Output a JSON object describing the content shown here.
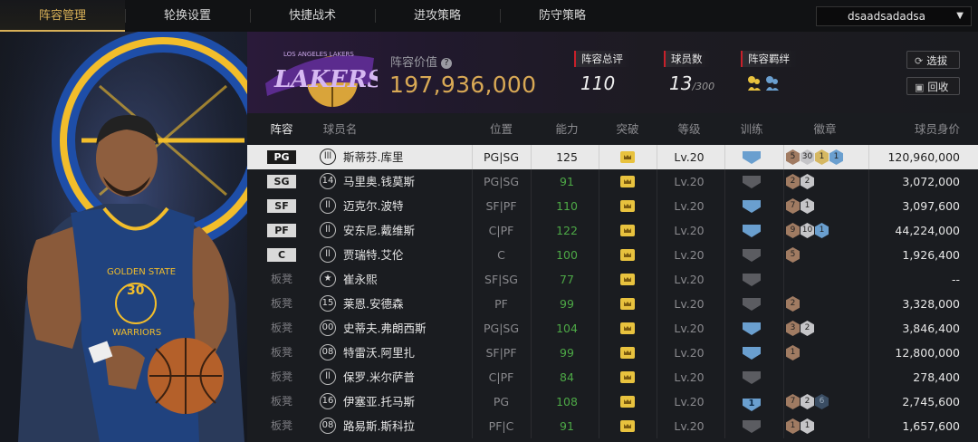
{
  "nav": {
    "tabs": [
      {
        "label": "阵容管理",
        "active": true
      },
      {
        "label": "轮换设置",
        "active": false
      },
      {
        "label": "快捷战术",
        "active": false
      },
      {
        "label": "进攻策略",
        "active": false
      },
      {
        "label": "防守策略",
        "active": false
      }
    ],
    "user": "dsaadsadadsa"
  },
  "header": {
    "team_logo_text": "LOS ANGELES LAKERS",
    "value_label": "阵容价值",
    "value": "197,936,000",
    "stats": [
      {
        "label": "阵容总评",
        "value": "110",
        "sub": ""
      },
      {
        "label": "球员数",
        "value": "13",
        "sub": "/300"
      },
      {
        "label": "阵容羁绊",
        "value": "",
        "sub": ""
      }
    ],
    "buttons": {
      "select": "选拔",
      "recycle": "回收"
    }
  },
  "table": {
    "columns": [
      "阵容",
      "球员名",
      "位置",
      "能力",
      "突破",
      "等级",
      "训练",
      "徽章",
      "球员身价"
    ],
    "rows": [
      {
        "slot": "PG",
        "bench": false,
        "jersey": "lll",
        "name": "斯蒂芬.库里",
        "position": "PG|SG",
        "rating": "125",
        "level": "Lv.20",
        "training": "blue",
        "training_num": "",
        "badges": [
          {
            "t": "bronze",
            "n": "5"
          },
          {
            "t": "silver",
            "n": "30"
          },
          {
            "t": "gold",
            "n": "1"
          },
          {
            "t": "blue",
            "n": "1"
          }
        ],
        "price": "120,960,000",
        "selected": true
      },
      {
        "slot": "SG",
        "bench": false,
        "jersey": "14",
        "name": "马里奥.钱莫斯",
        "position": "PG|SG",
        "rating": "91",
        "level": "Lv.20",
        "training": "grey",
        "training_num": "",
        "badges": [
          {
            "t": "bronze",
            "n": "2"
          },
          {
            "t": "silver",
            "n": "2"
          }
        ],
        "price": "3,072,000",
        "selected": false
      },
      {
        "slot": "SF",
        "bench": false,
        "jersey": "ll",
        "name": "迈克尔.波特",
        "position": "SF|PF",
        "rating": "110",
        "level": "Lv.20",
        "training": "blue",
        "training_num": "",
        "badges": [
          {
            "t": "bronze",
            "n": "7"
          },
          {
            "t": "silver",
            "n": "1"
          }
        ],
        "price": "3,097,600",
        "selected": false
      },
      {
        "slot": "PF",
        "bench": false,
        "jersey": "ll",
        "name": "安东尼.戴维斯",
        "position": "C|PF",
        "rating": "122",
        "level": "Lv.20",
        "training": "blue",
        "training_num": "",
        "badges": [
          {
            "t": "bronze",
            "n": "9"
          },
          {
            "t": "silver",
            "n": "10"
          },
          {
            "t": "blue",
            "n": "1"
          }
        ],
        "price": "44,224,000",
        "selected": false
      },
      {
        "slot": "C",
        "bench": false,
        "jersey": "ll",
        "name": "贾瑞特.艾伦",
        "position": "C",
        "rating": "100",
        "level": "Lv.20",
        "training": "grey",
        "training_num": "",
        "badges": [
          {
            "t": "bronze",
            "n": "5"
          }
        ],
        "price": "1,926,400",
        "selected": false
      },
      {
        "slot": "板凳",
        "bench": true,
        "jersey": "★",
        "name": "崔永熙",
        "position": "SF|SG",
        "rating": "77",
        "level": "Lv.20",
        "training": "grey",
        "training_num": "",
        "badges": [],
        "price": "--",
        "selected": false
      },
      {
        "slot": "板凳",
        "bench": true,
        "jersey": "15",
        "name": "莱恩.安德森",
        "position": "PF",
        "rating": "99",
        "level": "Lv.20",
        "training": "grey",
        "training_num": "",
        "badges": [
          {
            "t": "bronze",
            "n": "2"
          }
        ],
        "price": "3,328,000",
        "selected": false
      },
      {
        "slot": "板凳",
        "bench": true,
        "jersey": "00",
        "name": "史蒂夫.弗朗西斯",
        "position": "PG|SG",
        "rating": "104",
        "level": "Lv.20",
        "training": "blue",
        "training_num": "",
        "badges": [
          {
            "t": "bronze",
            "n": "3"
          },
          {
            "t": "silver",
            "n": "2"
          }
        ],
        "price": "3,846,400",
        "selected": false
      },
      {
        "slot": "板凳",
        "bench": true,
        "jersey": "08",
        "name": "特雷沃.阿里扎",
        "position": "SF|PF",
        "rating": "99",
        "level": "Lv.20",
        "training": "blue",
        "training_num": "",
        "badges": [
          {
            "t": "bronze",
            "n": "1"
          }
        ],
        "price": "12,800,000",
        "selected": false
      },
      {
        "slot": "板凳",
        "bench": true,
        "jersey": "ll",
        "name": "保罗.米尔萨普",
        "position": "C|PF",
        "rating": "84",
        "level": "Lv.20",
        "training": "grey",
        "training_num": "",
        "badges": [],
        "price": "278,400",
        "selected": false
      },
      {
        "slot": "板凳",
        "bench": true,
        "jersey": "16",
        "name": "伊塞亚.托马斯",
        "position": "PG",
        "rating": "108",
        "level": "Lv.20",
        "training": "blue",
        "training_num": "1",
        "badges": [
          {
            "t": "bronze",
            "n": "7"
          },
          {
            "t": "silver",
            "n": "2"
          },
          {
            "t": "dark",
            "n": "6"
          }
        ],
        "price": "2,745,600",
        "selected": false
      },
      {
        "slot": "板凳",
        "bench": true,
        "jersey": "08",
        "name": "路易斯.斯科拉",
        "position": "PF|C",
        "rating": "91",
        "level": "Lv.20",
        "training": "grey",
        "training_num": "",
        "badges": [
          {
            "t": "bronze",
            "n": "1"
          },
          {
            "t": "silver",
            "n": "1"
          }
        ],
        "price": "1,657,600",
        "selected": false
      }
    ]
  },
  "player_card": {
    "jersey_text": "GOLDEN STATE",
    "jersey_number": "30",
    "jersey_team": "WARRIORS"
  }
}
